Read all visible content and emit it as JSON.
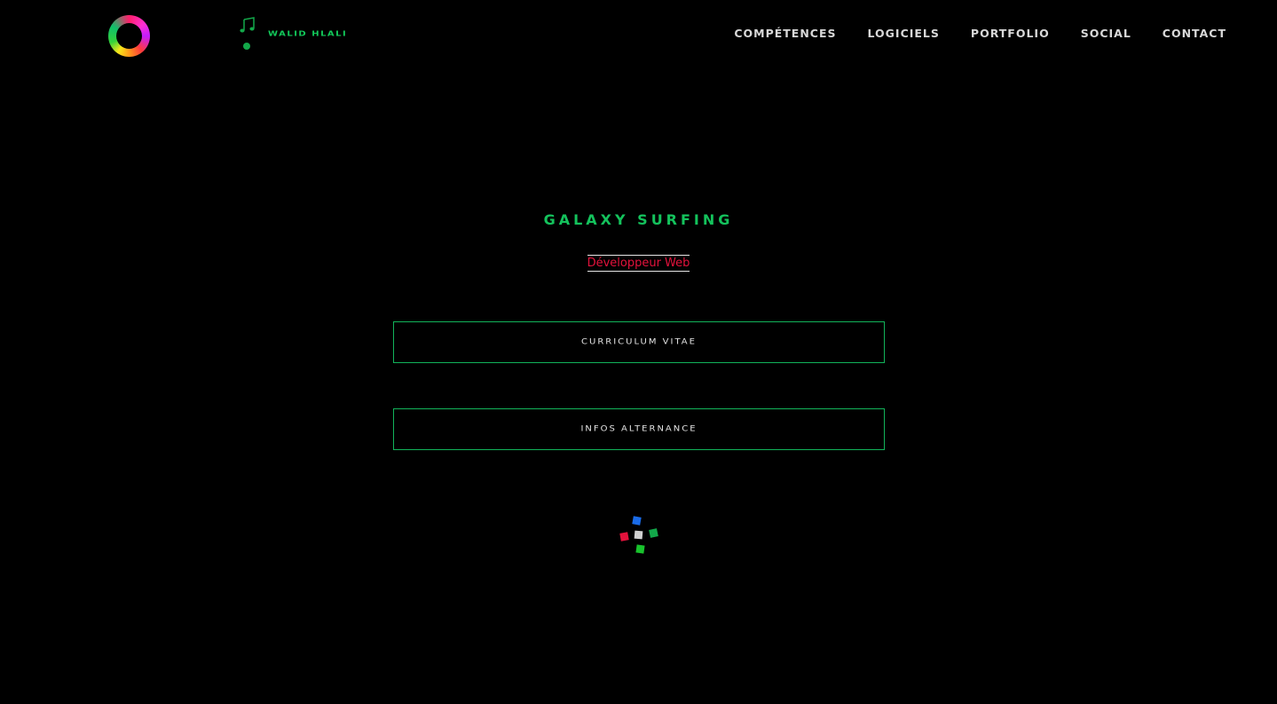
{
  "header": {
    "brand_name": "Walid Hlali",
    "nav": [
      {
        "label": "COMPÉTENCES"
      },
      {
        "label": "LOGICIELS"
      },
      {
        "label": "PORTFOLIO"
      },
      {
        "label": "SOCIAL"
      },
      {
        "label": "CONTACT"
      }
    ]
  },
  "hero": {
    "title": "Galaxy Surfing",
    "subtitle": "Développeur Web",
    "buttons": {
      "cv": "Curriculum Vitae",
      "alternance": "Infos Alternance"
    }
  },
  "colors": {
    "background": "#000000",
    "accent_green": "#14c25c",
    "accent_red": "#e3123c",
    "nav_text": "#d8d8d8",
    "loader_blue": "#1a6be8",
    "loader_grey": "#d0d0d0",
    "loader_red": "#e3123c",
    "loader_green": "#12a84a",
    "loader_green2": "#18c22c"
  },
  "icons": {
    "logo": "rainbow-ring-logo",
    "music": "music-note-icon",
    "loader": "spinning-squares-loader"
  }
}
